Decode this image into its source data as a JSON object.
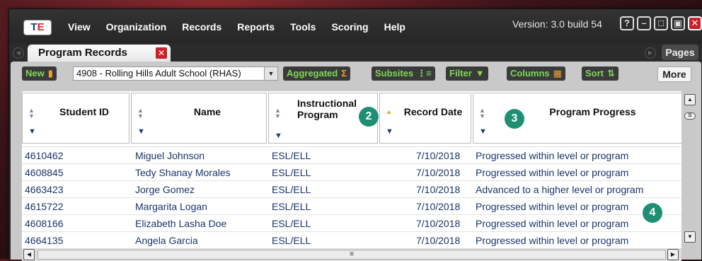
{
  "app": {
    "logo": {
      "t": "T",
      "e": "E"
    },
    "menu": [
      "View",
      "Organization",
      "Records",
      "Reports",
      "Tools",
      "Scoring",
      "Help"
    ],
    "version": "Version: 3.0 build 54",
    "window_buttons": [
      "?",
      "–",
      "□",
      "▣",
      "✕"
    ]
  },
  "tabs": {
    "active": "Program Records",
    "pages_label": "Pages"
  },
  "toolbar": {
    "new_label": "New",
    "site_value": "4908 - Rolling Hills Adult School (RHAS)",
    "aggregated_label": "Aggregated",
    "subsites_label": "Subsites",
    "filter_label": "Filter",
    "columns_label": "Columns",
    "sort_label": "Sort",
    "more_label": "More"
  },
  "columns": [
    {
      "label": "Student ID"
    },
    {
      "label": "Name"
    },
    {
      "label": "Instructional Program"
    },
    {
      "label": "Record Date"
    },
    {
      "label": "Program Progress"
    }
  ],
  "rows": [
    {
      "student_id": "4610462",
      "name": "Miguel Johnson",
      "program": "ESL/ELL",
      "date": "7/10/2018",
      "progress": "Progressed within level or program"
    },
    {
      "student_id": "4608845",
      "name": "Tedy Shanay Morales",
      "program": "ESL/ELL",
      "date": "7/10/2018",
      "progress": "Progressed within level or program"
    },
    {
      "student_id": "4663423",
      "name": "Jorge Gomez",
      "program": "ESL/ELL",
      "date": "7/10/2018",
      "progress": "Advanced to a higher level or program"
    },
    {
      "student_id": "4615722",
      "name": "Margarita Logan",
      "program": "ESL/ELL",
      "date": "7/10/2018",
      "progress": "Progressed within level or program"
    },
    {
      "student_id": "4608166",
      "name": "Elizabeth Lasha Doe",
      "program": "ESL/ELL",
      "date": "7/10/2018",
      "progress": "Progressed within level or program"
    },
    {
      "student_id": "4664135",
      "name": "Angela Garcia",
      "program": "ESL/ELL",
      "date": "7/10/2018",
      "progress": "Progressed within level or program"
    }
  ],
  "callouts": [
    "2",
    "3",
    "4"
  ],
  "colors": {
    "accent_green": "#7ed957",
    "accent_orange": "#f0a030",
    "close_red": "#c8222a",
    "badge_teal": "#1e8f72",
    "link_blue": "#1a3568"
  }
}
